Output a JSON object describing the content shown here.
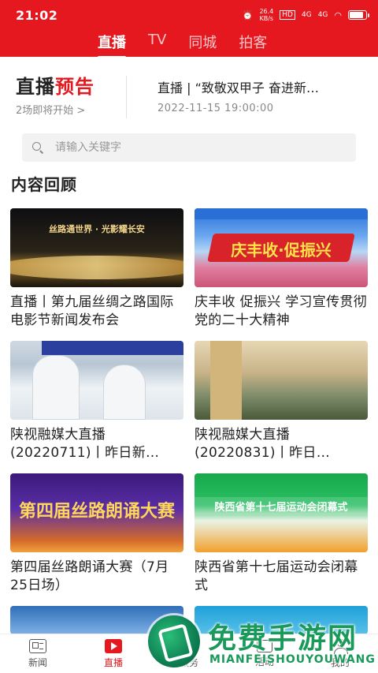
{
  "status_bar": {
    "time": "21:02",
    "network_speed": "26.4\nKB/s",
    "hd_badge": "HD",
    "signal1": "4G",
    "signal2": "4G",
    "battery_level": 0.9
  },
  "top_tabs": [
    {
      "label": "直播",
      "active": true
    },
    {
      "label": "TV",
      "active": false
    },
    {
      "label": "同城",
      "active": false
    },
    {
      "label": "拍客",
      "active": false
    }
  ],
  "preview": {
    "title_part1": "直播",
    "title_part2": "预告",
    "subtitle": "2场即将开始 >",
    "item_text": "直播 | “致敬双甲子 奋进新…",
    "item_date": "2022-11-15 19:00:00"
  },
  "search": {
    "placeholder": "请输入关键字"
  },
  "section": {
    "title": "内容回顾"
  },
  "cards": [
    {
      "title": "直播丨第九届丝绸之路国际电影节新闻发布会",
      "thumb_text": "丝路通世界 · 光影耀长安"
    },
    {
      "title": "庆丰收 促振兴 学习宣传贯彻党的二十大精神",
      "thumb_text": "庆丰收·促振兴"
    },
    {
      "title": "陕视融媒大直播(20220711)丨昨日新…",
      "thumb_text": ""
    },
    {
      "title": "陕视融媒大直播(20220831)丨昨日…",
      "thumb_text": ""
    },
    {
      "title": "第四届丝路朗诵大赛（7月25日场）",
      "thumb_text": "第四届丝路朗诵大赛"
    },
    {
      "title": "陕西省第十七届运动会闭幕式",
      "thumb_text": "陕西省第十七届运动会闭幕式"
    },
    {
      "title": "",
      "thumb_text": ""
    },
    {
      "title": "",
      "thumb_text": ""
    }
  ],
  "bottom_nav": [
    {
      "label": "新闻",
      "icon": "news-icon",
      "active": false
    },
    {
      "label": "直播",
      "icon": "live-icon",
      "active": true
    },
    {
      "label": "服务",
      "icon": "service-icon",
      "active": false
    },
    {
      "label": "活动",
      "icon": "activity-icon",
      "active": false
    },
    {
      "label": "我的",
      "icon": "profile-icon",
      "active": false
    }
  ],
  "watermark": {
    "text": "免费手游网",
    "sub": "MIANFEISHOUYOUWANG"
  },
  "colors": {
    "brand_red": "#e5171f",
    "watermark_green": "#1a9a5a"
  }
}
